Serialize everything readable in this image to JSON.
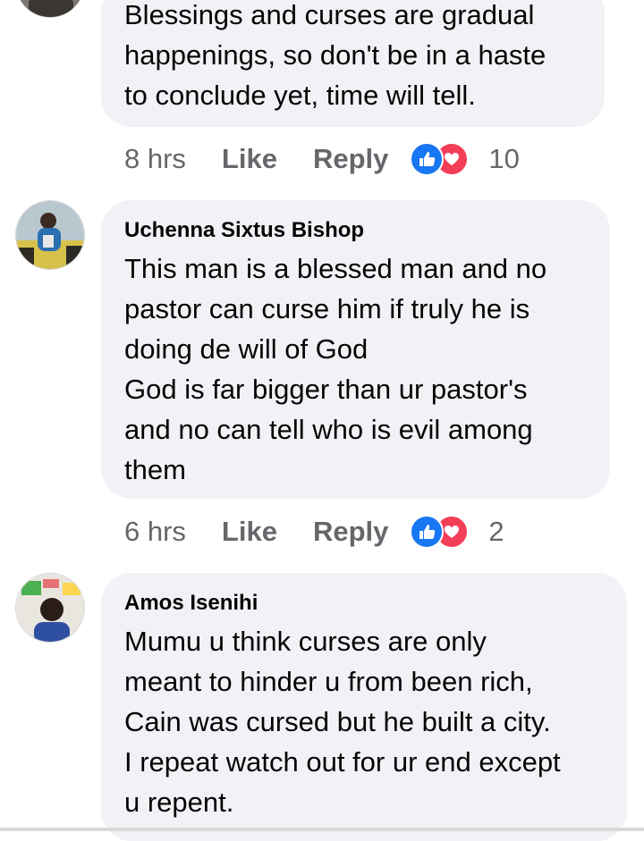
{
  "comments": [
    {
      "author": "",
      "text": "Blessings and curses are gradual\nhappenings, so don't be in a haste\nto conclude yet, time will tell.",
      "time": "8 hrs",
      "like_label": "Like",
      "reply_label": "Reply",
      "reaction_count": "10",
      "reactions": [
        "like-icon",
        "love-icon"
      ]
    },
    {
      "author": "Uchenna Sixtus Bishop",
      "text": "This man is a blessed man and no\npastor can curse him if truly he is\ndoing de will of God\nGod is far bigger than ur pastor's\nand no can tell who is evil among\nthem",
      "time": "6 hrs",
      "like_label": "Like",
      "reply_label": "Reply",
      "reaction_count": "2",
      "reactions": [
        "like-icon",
        "love-icon"
      ]
    },
    {
      "author": "Amos Isenihi",
      "text": "Mumu u think curses are only\nmeant to hinder u from been rich,\nCain was cursed but he built a city.\nI repeat watch out for ur end except\nu repent."
    }
  ],
  "colors": {
    "bubble_bg": "#f0f2f5",
    "meta_text": "#65676b",
    "like_blue": "#1877f2",
    "love_red": "#f33e58"
  }
}
